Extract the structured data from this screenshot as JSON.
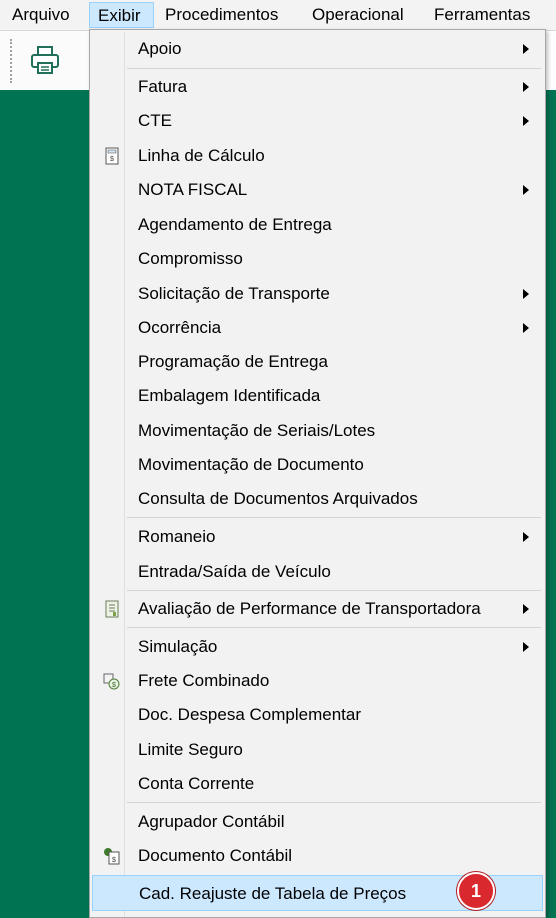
{
  "menubar": {
    "items": [
      "Arquivo",
      "Exibir",
      "Procedimentos",
      "Operacional",
      "Ferramentas"
    ]
  },
  "dropdown": {
    "items": [
      {
        "label": "Apoio",
        "submenu": true
      },
      {
        "label": "Fatura",
        "submenu": true
      },
      {
        "label": "CTE",
        "submenu": true
      },
      {
        "label": "Linha de Cálculo",
        "icon": "calculator-sheet-icon"
      },
      {
        "label": "NOTA FISCAL",
        "submenu": true
      },
      {
        "label": "Agendamento de Entrega"
      },
      {
        "label": "Compromisso"
      },
      {
        "label": "Solicitação de Transporte",
        "submenu": true
      },
      {
        "label": "Ocorrência",
        "submenu": true
      },
      {
        "label": "Programação de Entrega"
      },
      {
        "label": "Embalagem Identificada"
      },
      {
        "label": "Movimentação de Seriais/Lotes"
      },
      {
        "label": "Movimentação de Documento"
      },
      {
        "label": "Consulta de Documentos Arquivados"
      },
      {
        "label": "Romaneio",
        "submenu": true
      },
      {
        "label": "Entrada/Saída de Veículo"
      },
      {
        "label": "Avaliação de Performance de Transportadora",
        "submenu": true,
        "icon": "report-icon"
      },
      {
        "label": "Simulação",
        "submenu": true
      },
      {
        "label": "Frete Combinado",
        "icon": "combined-freight-icon"
      },
      {
        "label": "Doc. Despesa Complementar"
      },
      {
        "label": "Limite Seguro"
      },
      {
        "label": "Conta Corrente"
      },
      {
        "label": "Agrupador Contábil"
      },
      {
        "label": "Documento Contábil",
        "icon": "accounting-document-icon"
      },
      {
        "label": "Cad. Reajuste de Tabela de Preços",
        "highlighted": true
      }
    ],
    "badge": "1"
  },
  "colors": {
    "background": "#007353",
    "highlight": "#cce8ff",
    "badge": "#d9282e"
  }
}
